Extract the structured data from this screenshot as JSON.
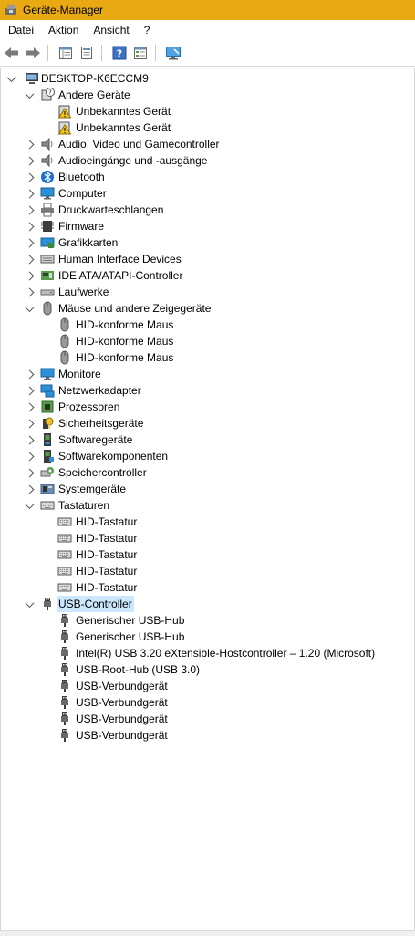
{
  "window": {
    "title": "Geräte-Manager"
  },
  "menu": [
    "Datei",
    "Aktion",
    "Ansicht",
    "?"
  ],
  "toolbar": [
    "back-arrow-icon",
    "forward-arrow-icon",
    "details-view-icon",
    "properties-icon",
    "help-icon",
    "list-view-icon",
    "monitor-scan-icon"
  ],
  "tree": [
    {
      "label": "DESKTOP-K6ECCM9",
      "level": 0,
      "expander": "open",
      "icon": "computer-root-icon"
    },
    {
      "label": "Andere Geräte",
      "level": 1,
      "expander": "open",
      "icon": "unknown-device-icon"
    },
    {
      "label": "Unbekanntes Gerät",
      "level": 2,
      "expander": "none",
      "icon": "warning-device-icon"
    },
    {
      "label": "Unbekanntes Gerät",
      "level": 2,
      "expander": "none",
      "icon": "warning-device-icon"
    },
    {
      "label": "Audio, Video und Gamecontroller",
      "level": 1,
      "expander": "closed",
      "icon": "speaker-icon"
    },
    {
      "label": "Audioeingänge und -ausgänge",
      "level": 1,
      "expander": "closed",
      "icon": "speaker-icon"
    },
    {
      "label": "Bluetooth",
      "level": 1,
      "expander": "closed",
      "icon": "bluetooth-icon"
    },
    {
      "label": "Computer",
      "level": 1,
      "expander": "closed",
      "icon": "monitor-icon"
    },
    {
      "label": "Druckwarteschlangen",
      "level": 1,
      "expander": "closed",
      "icon": "printer-icon"
    },
    {
      "label": "Firmware",
      "level": 1,
      "expander": "closed",
      "icon": "firmware-icon"
    },
    {
      "label": "Grafikkarten",
      "level": 1,
      "expander": "closed",
      "icon": "display-adapter-icon"
    },
    {
      "label": "Human Interface Devices",
      "level": 1,
      "expander": "closed",
      "icon": "hid-icon"
    },
    {
      "label": "IDE ATA/ATAPI-Controller",
      "level": 1,
      "expander": "closed",
      "icon": "ide-controller-icon"
    },
    {
      "label": "Laufwerke",
      "level": 1,
      "expander": "closed",
      "icon": "disk-drive-icon"
    },
    {
      "label": "Mäuse und andere Zeigegeräte",
      "level": 1,
      "expander": "open",
      "icon": "mouse-icon"
    },
    {
      "label": "HID-konforme Maus",
      "level": 2,
      "expander": "none",
      "icon": "mouse-icon"
    },
    {
      "label": "HID-konforme Maus",
      "level": 2,
      "expander": "none",
      "icon": "mouse-icon"
    },
    {
      "label": "HID-konforme Maus",
      "level": 2,
      "expander": "none",
      "icon": "mouse-icon"
    },
    {
      "label": "Monitore",
      "level": 1,
      "expander": "closed",
      "icon": "monitor-icon"
    },
    {
      "label": "Netzwerkadapter",
      "level": 1,
      "expander": "closed",
      "icon": "network-adapter-icon"
    },
    {
      "label": "Prozessoren",
      "level": 1,
      "expander": "closed",
      "icon": "processor-icon"
    },
    {
      "label": "Sicherheitsgeräte",
      "level": 1,
      "expander": "closed",
      "icon": "security-key-icon"
    },
    {
      "label": "Softwaregeräte",
      "level": 1,
      "expander": "closed",
      "icon": "software-device-icon"
    },
    {
      "label": "Softwarekomponenten",
      "level": 1,
      "expander": "closed",
      "icon": "software-component-icon"
    },
    {
      "label": "Speichercontroller",
      "level": 1,
      "expander": "closed",
      "icon": "storage-controller-icon"
    },
    {
      "label": "Systemgeräte",
      "level": 1,
      "expander": "closed",
      "icon": "system-device-icon"
    },
    {
      "label": "Tastaturen",
      "level": 1,
      "expander": "open",
      "icon": "keyboard-icon"
    },
    {
      "label": "HID-Tastatur",
      "level": 2,
      "expander": "none",
      "icon": "keyboard-icon"
    },
    {
      "label": "HID-Tastatur",
      "level": 2,
      "expander": "none",
      "icon": "keyboard-icon"
    },
    {
      "label": "HID-Tastatur",
      "level": 2,
      "expander": "none",
      "icon": "keyboard-icon"
    },
    {
      "label": "HID-Tastatur",
      "level": 2,
      "expander": "none",
      "icon": "keyboard-icon"
    },
    {
      "label": "HID-Tastatur",
      "level": 2,
      "expander": "none",
      "icon": "keyboard-icon"
    },
    {
      "label": "USB-Controller",
      "level": 1,
      "expander": "open",
      "icon": "usb-plug-icon",
      "selected": true
    },
    {
      "label": "Generischer USB-Hub",
      "level": 2,
      "expander": "none",
      "icon": "usb-plug-icon"
    },
    {
      "label": "Generischer USB-Hub",
      "level": 2,
      "expander": "none",
      "icon": "usb-plug-icon"
    },
    {
      "label": "Intel(R) USB 3.20 eXtensible-Hostcontroller – 1.20 (Microsoft)",
      "level": 2,
      "expander": "none",
      "icon": "usb-plug-icon"
    },
    {
      "label": "USB-Root-Hub (USB 3.0)",
      "level": 2,
      "expander": "none",
      "icon": "usb-plug-icon"
    },
    {
      "label": "USB-Verbundgerät",
      "level": 2,
      "expander": "none",
      "icon": "usb-plug-icon"
    },
    {
      "label": "USB-Verbundgerät",
      "level": 2,
      "expander": "none",
      "icon": "usb-plug-icon"
    },
    {
      "label": "USB-Verbundgerät",
      "level": 2,
      "expander": "none",
      "icon": "usb-plug-icon"
    },
    {
      "label": "USB-Verbundgerät",
      "level": 2,
      "expander": "none",
      "icon": "usb-plug-icon"
    }
  ],
  "colors": {
    "titlebar": "#e8a913",
    "selection": "#cce8ff"
  }
}
